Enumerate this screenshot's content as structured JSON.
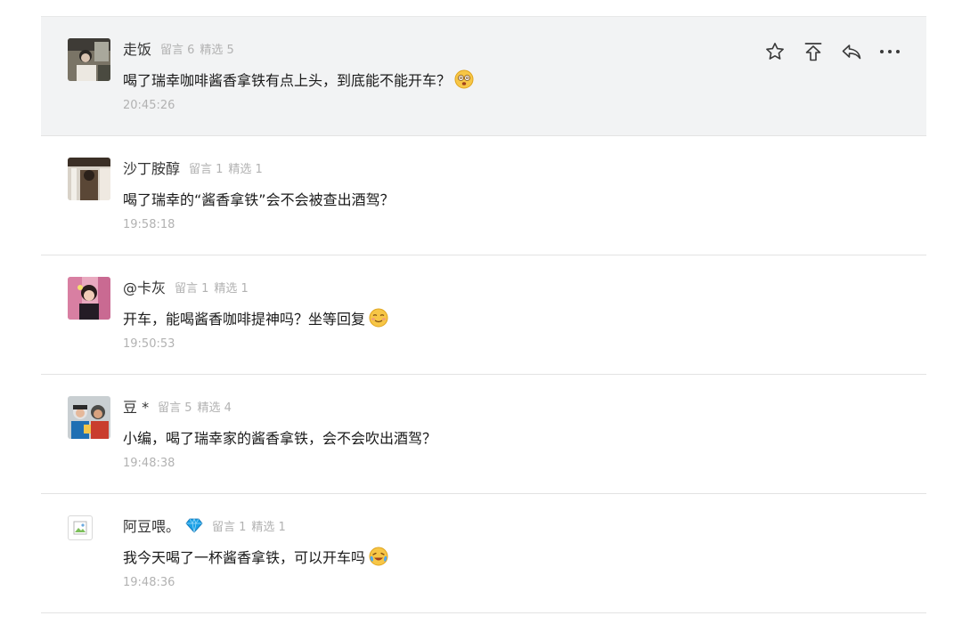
{
  "comments": [
    {
      "nickname": "走饭",
      "meta_messages": "留言 6",
      "meta_featured": "精选 5",
      "content": "喝了瑞幸咖啡酱香拿铁有点上头，到底能不能开车？",
      "content_emoji": "dizzy-face-emoji",
      "time": "20:45:26",
      "highlighted": true,
      "actions": [
        "star-icon",
        "pin-to-top-icon",
        "reply-icon",
        "more-icon"
      ]
    },
    {
      "nickname": "沙丁胺醇",
      "meta_messages": "留言 1",
      "meta_featured": "精选 1",
      "content": "喝了瑞幸的“酱香拿铁”会不会被查出酒驾？",
      "time": "19:58:18"
    },
    {
      "nickname": "@卡灰",
      "meta_messages": "留言 1",
      "meta_featured": "精选 1",
      "content": "开车，能喝酱香咖啡提神吗？坐等回复",
      "content_emoji": "smirk-emoji",
      "time": "19:50:53"
    },
    {
      "nickname": "豆 *",
      "meta_messages": "留言 5",
      "meta_featured": "精选 4",
      "content": "小编，喝了瑞幸家的酱香拿铁，会不会吹出酒驾？",
      "time": "19:48:38"
    },
    {
      "nickname": "阿豆喂。",
      "nickname_badge": "diamond-icon",
      "meta_messages": "留言 1",
      "meta_featured": "精选 1",
      "content": "我今天喝了一杯酱香拿铁，可以开车吗",
      "content_emoji": "laugh-cry-emoji",
      "time": "19:48:36"
    }
  ],
  "colors": {
    "highlight_bg": "#f2f3f4",
    "divider": "#e3e3e3",
    "meta_text": "#b2b2b2",
    "content_text": "#1a1a1a",
    "diamond": "#1aa0e6"
  }
}
